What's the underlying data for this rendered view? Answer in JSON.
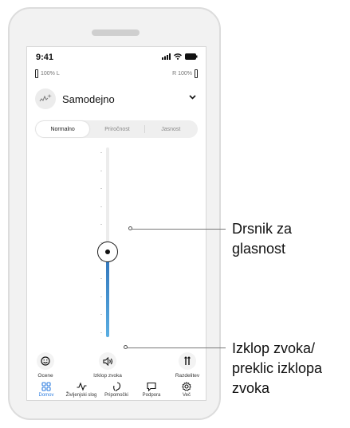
{
  "status_bar": {
    "time": "9:41"
  },
  "battery": {
    "left_label": "100% L",
    "right_label": "R 100%"
  },
  "program": {
    "name": "Samodejno"
  },
  "segments": [
    {
      "label": "Normalno",
      "active": true
    },
    {
      "label": "Priročnost",
      "active": false
    },
    {
      "label": "Jasnost",
      "active": false
    }
  ],
  "volume": {
    "level": 0.45
  },
  "actions": [
    {
      "label": "Ocene",
      "icon": "smiley-icon"
    },
    {
      "label": "Izklop zvoka",
      "icon": "speaker-icon"
    },
    {
      "label": "Razdelitev",
      "icon": "split-icon"
    }
  ],
  "tabs": [
    {
      "label": "Domov",
      "icon": "home-grid-icon",
      "active": true
    },
    {
      "label": "Življenjski slog",
      "icon": "activity-icon",
      "active": false
    },
    {
      "label": "Pripomočki",
      "icon": "hearing-aid-icon",
      "active": false
    },
    {
      "label": "Podpora",
      "icon": "chat-icon",
      "active": false
    },
    {
      "label": "Več",
      "icon": "gear-icon",
      "active": false
    }
  ],
  "callouts": {
    "slider_line1": "Drsnik za",
    "slider_line2": "glasnost",
    "mute_line1": "Izklop zvoka/",
    "mute_line2": "preklic izklopa",
    "mute_line3": "zvoka"
  },
  "colors": {
    "accent": "#2f7ee0",
    "slider_top": "#2f72b9",
    "slider_bottom": "#5aaee2"
  }
}
